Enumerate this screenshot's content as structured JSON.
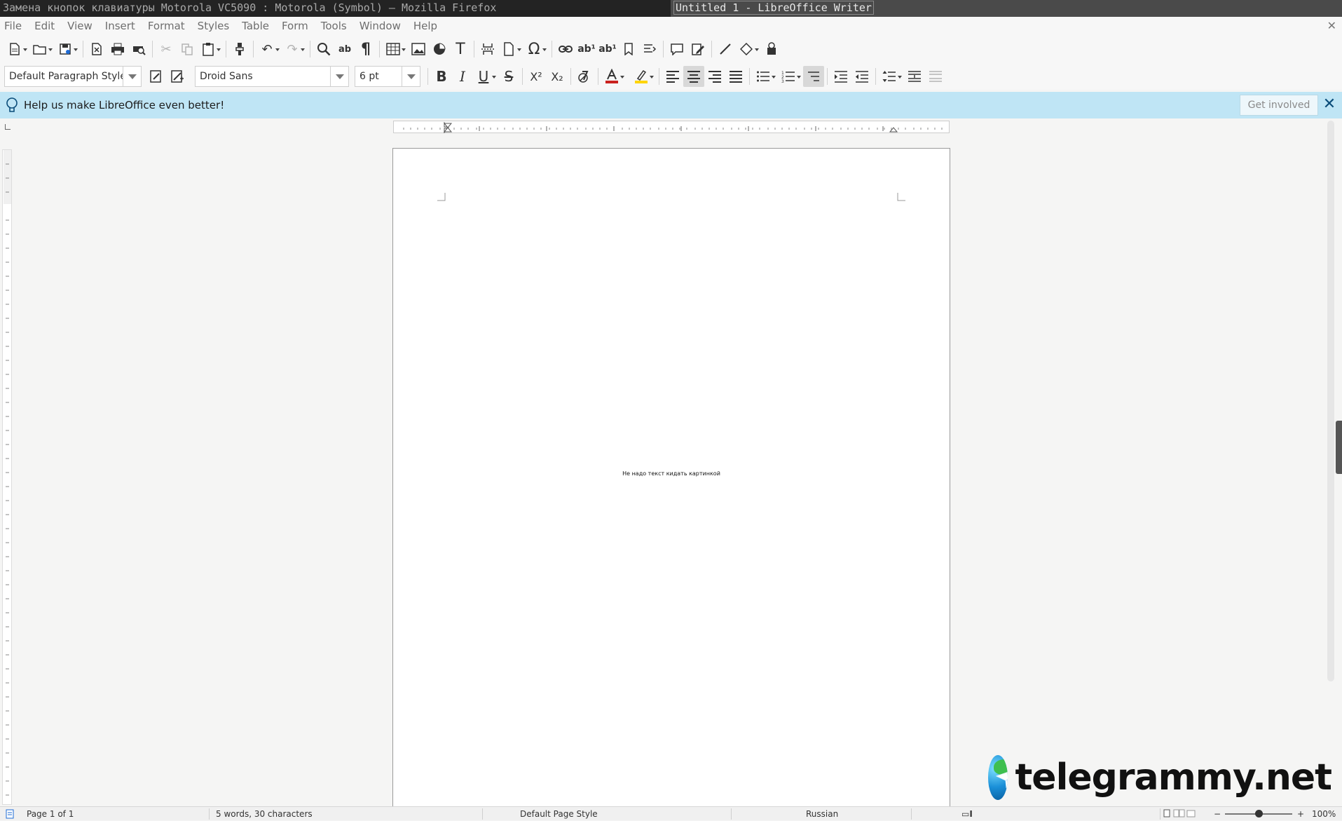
{
  "titlebar": {
    "browser_title": "Замена кнопок клавиатуры Motorola VC5090 : Motorola (Symbol) — Mozilla Firefox",
    "app_title": "Untitled 1 - LibreOffice Writer"
  },
  "menu": [
    "File",
    "Edit",
    "View",
    "Insert",
    "Format",
    "Styles",
    "Table",
    "Form",
    "Tools",
    "Window",
    "Help"
  ],
  "formatting": {
    "paragraph_style": "Default Paragraph Style",
    "font_name": "Droid Sans",
    "font_size": "6 pt"
  },
  "infobar": {
    "message": "Help us make LibreOffice even better!",
    "button": "Get involved"
  },
  "document": {
    "text": "Не надо текст кидать картинкой"
  },
  "watermark": {
    "text": "telegrammy.net"
  },
  "statusbar": {
    "page": "Page 1 of 1",
    "counts": "5 words, 30 characters",
    "page_style": "Default Page Style",
    "language": "Russian",
    "zoom": "100%"
  },
  "colors": {
    "font_color": "#c9211e",
    "highlight_color": "#ffd500",
    "infobar_bg": "#bfe5f5"
  }
}
